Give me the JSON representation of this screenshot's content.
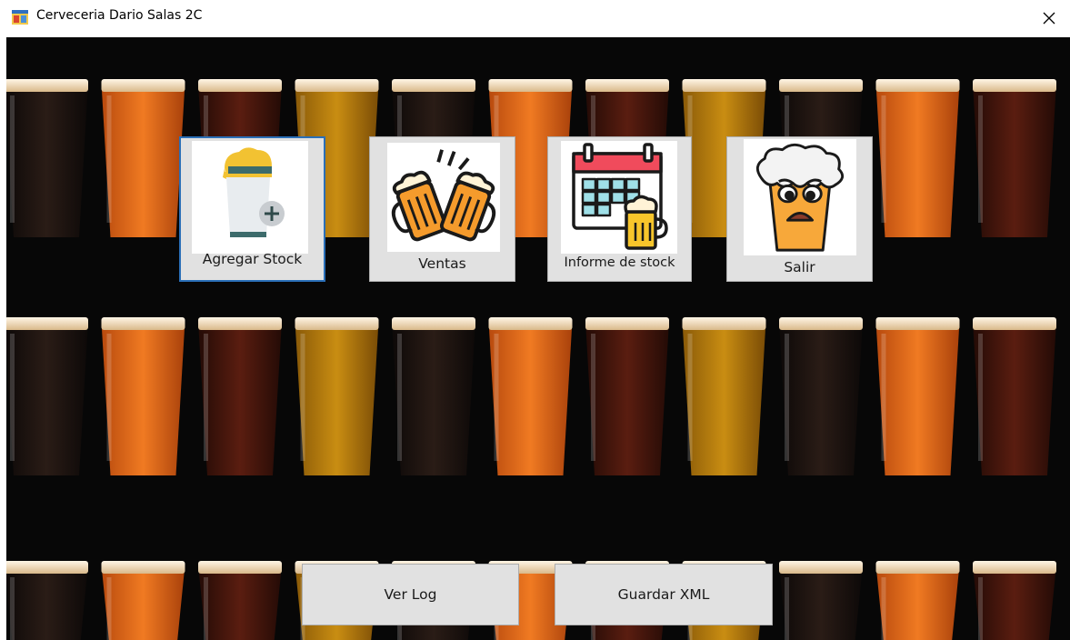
{
  "window": {
    "title": "Cerveceria Dario Salas 2C",
    "app_icon": "windows-form-icon",
    "close_icon": "close-icon"
  },
  "background": {
    "description_icon": "beer-glasses-background",
    "colors": {
      "dark": "#0a0a0a",
      "amber": "#e36a1a",
      "gold": "#f0b21a",
      "stout": "#1e1411",
      "red": "#4a1810",
      "foam": "#f4e2c4"
    }
  },
  "tiles": [
    {
      "id": "agregar",
      "label": "Agregar Stock",
      "icon": "beer-glass-add-icon"
    },
    {
      "id": "ventas",
      "label": "Ventas",
      "icon": "beer-cheers-icon"
    },
    {
      "id": "informe",
      "label": "Informe de stock",
      "icon": "calendar-beer-icon"
    },
    {
      "id": "salir",
      "label": "Salir",
      "icon": "sad-beer-icon"
    }
  ],
  "buttons": {
    "ver_log": "Ver Log",
    "guardar_xml": "Guardar XML"
  },
  "accent_color": "#2a6fb7"
}
